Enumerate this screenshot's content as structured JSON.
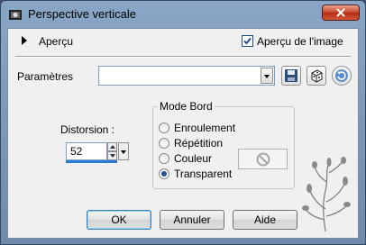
{
  "window": {
    "title": "Perspective verticale"
  },
  "apercu": {
    "label": "Aperçu",
    "image_preview_label": "Aperçu de l'image",
    "image_preview_checked": true
  },
  "parametres": {
    "label": "Paramètres",
    "combo_value": ""
  },
  "distorsion": {
    "label": "Distorsion :",
    "value": "52"
  },
  "mode_bord": {
    "title": "Mode Bord",
    "options": [
      "Enroulement",
      "Répétition",
      "Couleur",
      "Transparent"
    ],
    "selected": "Transparent"
  },
  "buttons": {
    "ok": "OK",
    "annuler": "Annuler",
    "aide": "Aide"
  },
  "colors": {
    "title_bar": "#8aa6c6",
    "close_button": "#c8442a",
    "accent": "#2a7bd4"
  }
}
